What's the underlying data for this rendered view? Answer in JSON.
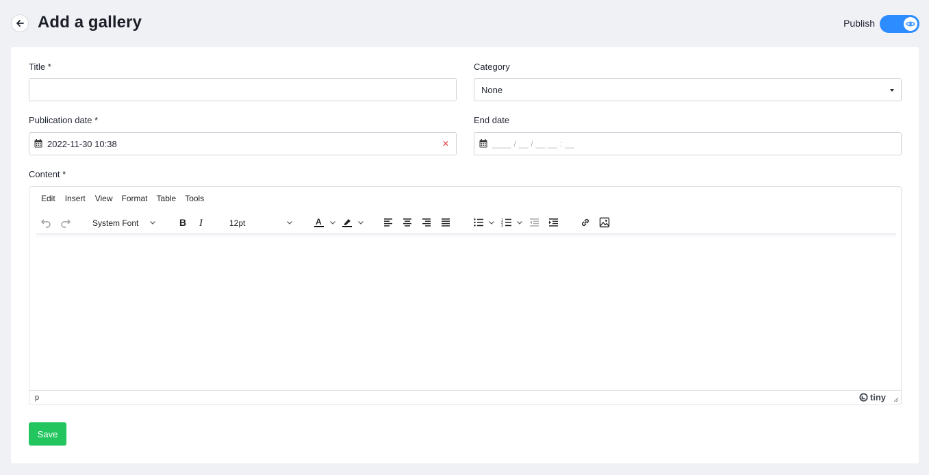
{
  "header": {
    "title": "Add a gallery",
    "publish_label": "Publish",
    "publish_on": true
  },
  "form": {
    "title_label": "Title *",
    "title_value": "",
    "category_label": "Category",
    "category_value": "None",
    "pubdate_label": "Publication date *",
    "pubdate_value": "2022-11-30 10:38",
    "enddate_label": "End date",
    "enddate_placeholder": "____ / __ / __ __ : __",
    "content_label": "Content *"
  },
  "editor": {
    "menu": [
      "Edit",
      "Insert",
      "View",
      "Format",
      "Table",
      "Tools"
    ],
    "font_family": "System Font",
    "font_size": "12pt",
    "path": "p",
    "brand": "tiny"
  },
  "actions": {
    "save_label": "Save"
  },
  "colors": {
    "accent": "#2d8cff",
    "save": "#22c55e",
    "clear": "#e43c3c"
  }
}
